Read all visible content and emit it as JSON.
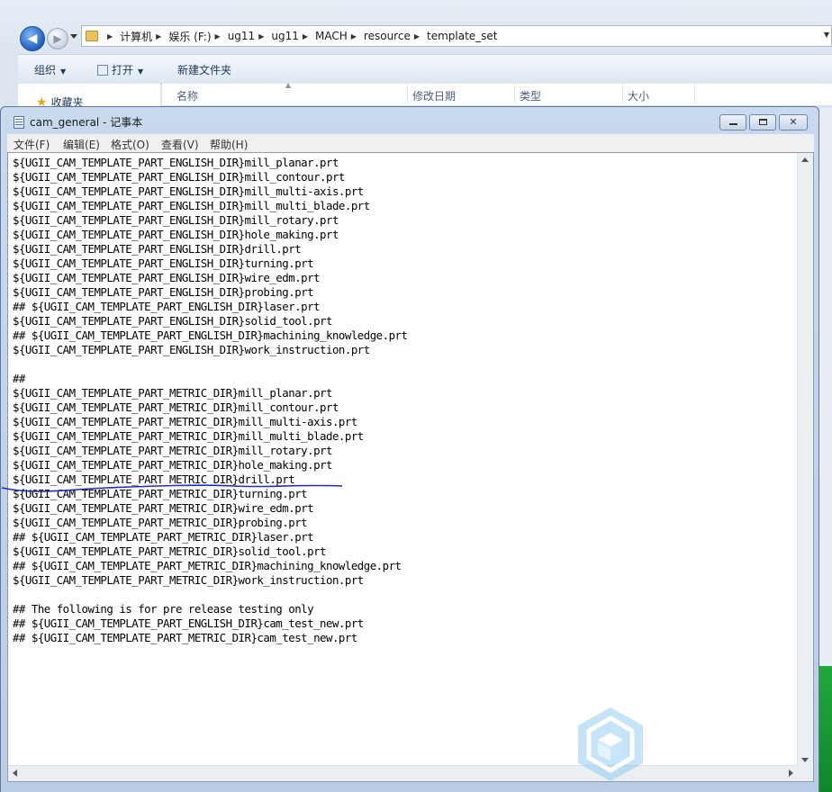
{
  "explorer": {
    "breadcrumbs": [
      "计算机",
      "娱乐 (F:)",
      "ug11",
      "ug11",
      "MACH",
      "resource",
      "template_set"
    ],
    "toolbar": {
      "organize": "组织",
      "open": "打开",
      "new_folder": "新建文件夹"
    },
    "sidebar": {
      "favorites": "收藏夹"
    },
    "columns": {
      "name": "名称",
      "modified": "修改日期",
      "type": "类型",
      "size": "大小"
    }
  },
  "notepad": {
    "title": "cam_general - 记事本",
    "menu": [
      "文件(F)",
      "编辑(E)",
      "格式(O)",
      "查看(V)",
      "帮助(H)"
    ],
    "lines": [
      "${UGII_CAM_TEMPLATE_PART_ENGLISH_DIR}mill_planar.prt",
      "${UGII_CAM_TEMPLATE_PART_ENGLISH_DIR}mill_contour.prt",
      "${UGII_CAM_TEMPLATE_PART_ENGLISH_DIR}mill_multi-axis.prt",
      "${UGII_CAM_TEMPLATE_PART_ENGLISH_DIR}mill_multi_blade.prt",
      "${UGII_CAM_TEMPLATE_PART_ENGLISH_DIR}mill_rotary.prt",
      "${UGII_CAM_TEMPLATE_PART_ENGLISH_DIR}hole_making.prt",
      "${UGII_CAM_TEMPLATE_PART_ENGLISH_DIR}drill.prt",
      "${UGII_CAM_TEMPLATE_PART_ENGLISH_DIR}turning.prt",
      "${UGII_CAM_TEMPLATE_PART_ENGLISH_DIR}wire_edm.prt",
      "${UGII_CAM_TEMPLATE_PART_ENGLISH_DIR}probing.prt",
      "## ${UGII_CAM_TEMPLATE_PART_ENGLISH_DIR}laser.prt",
      "${UGII_CAM_TEMPLATE_PART_ENGLISH_DIR}solid_tool.prt",
      "## ${UGII_CAM_TEMPLATE_PART_ENGLISH_DIR}machining_knowledge.prt",
      "${UGII_CAM_TEMPLATE_PART_ENGLISH_DIR}work_instruction.prt",
      "",
      "##",
      "${UGII_CAM_TEMPLATE_PART_METRIC_DIR}mill_planar.prt",
      "${UGII_CAM_TEMPLATE_PART_METRIC_DIR}mill_contour.prt",
      "${UGII_CAM_TEMPLATE_PART_METRIC_DIR}mill_multi-axis.prt",
      "${UGII_CAM_TEMPLATE_PART_METRIC_DIR}mill_multi_blade.prt",
      "${UGII_CAM_TEMPLATE_PART_METRIC_DIR}mill_rotary.prt",
      "${UGII_CAM_TEMPLATE_PART_METRIC_DIR}hole_making.prt",
      "${UGII_CAM_TEMPLATE_PART_METRIC_DIR}drill.prt",
      "${UGII_CAM_TEMPLATE_PART_METRIC_DIR}turning.prt",
      "${UGII_CAM_TEMPLATE_PART_METRIC_DIR}wire_edm.prt",
      "${UGII_CAM_TEMPLATE_PART_METRIC_DIR}probing.prt",
      "## ${UGII_CAM_TEMPLATE_PART_METRIC_DIR}laser.prt",
      "${UGII_CAM_TEMPLATE_PART_METRIC_DIR}solid_tool.prt",
      "## ${UGII_CAM_TEMPLATE_PART_METRIC_DIR}machining_knowledge.prt",
      "${UGII_CAM_TEMPLATE_PART_METRIC_DIR}work_instruction.prt",
      "",
      "## The following is for pre release testing only",
      "## ${UGII_CAM_TEMPLATE_PART_ENGLISH_DIR}cam_test_new.prt",
      "## ${UGII_CAM_TEMPLATE_PART_METRIC_DIR}cam_test_new.prt"
    ]
  },
  "colors": {
    "ink_underline": "#1d2bd6",
    "accent": "#1f5fbf"
  }
}
